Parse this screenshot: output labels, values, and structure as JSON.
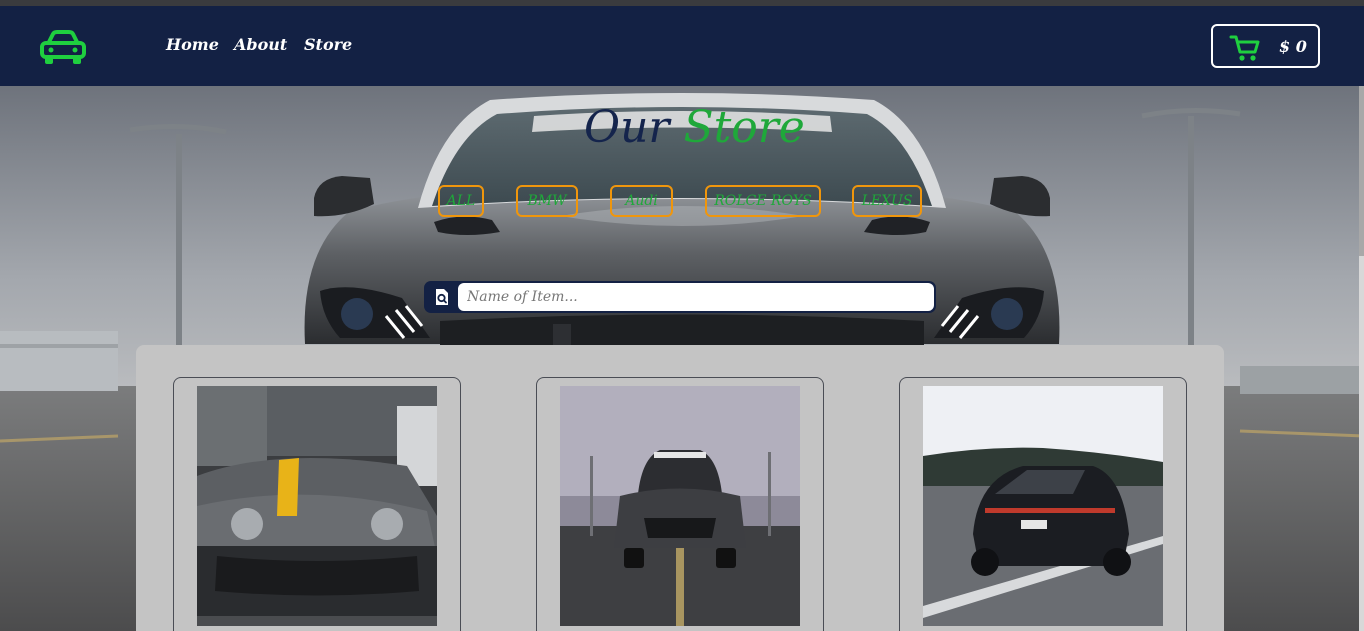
{
  "nav": {
    "logo_icon": "car-icon",
    "links": [
      {
        "label": "Home"
      },
      {
        "label": "About"
      },
      {
        "label": "Store"
      }
    ],
    "cart": {
      "icon": "cart-icon",
      "total": "$ 0"
    }
  },
  "hero": {
    "title_word1": "Our",
    "title_word2": "Store",
    "filters": [
      {
        "label": "ALL"
      },
      {
        "label": "BMW"
      },
      {
        "label": "Audi"
      },
      {
        "label": "ROLCE ROYS"
      },
      {
        "label": "LEXUS"
      }
    ],
    "search": {
      "icon": "search-file-icon",
      "placeholder": "Name of Item...",
      "value": ""
    }
  },
  "products": [
    {
      "image": "grey-mercedes-with-yellow-stripe"
    },
    {
      "image": "grey-mustang-front-view"
    },
    {
      "image": "black-porsche-rear-view"
    }
  ],
  "colors": {
    "navbar": "#132144",
    "accent_green": "#1fa83a",
    "filter_border": "#f0960c",
    "panel": "#c4c4c4"
  }
}
